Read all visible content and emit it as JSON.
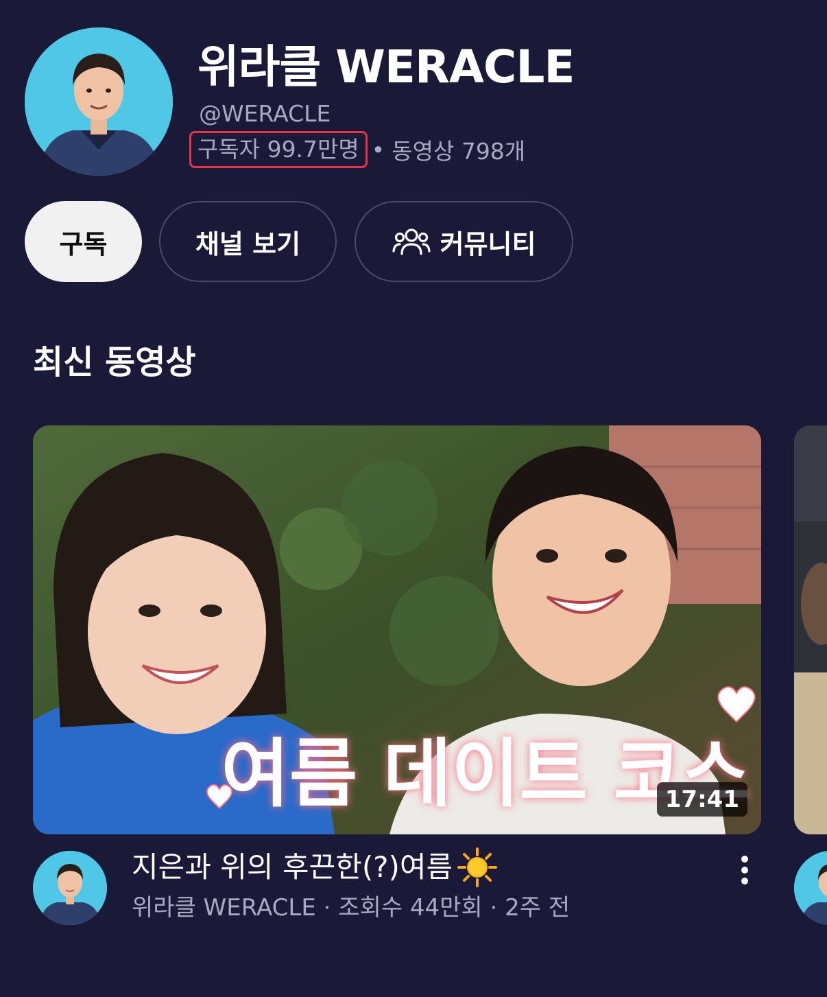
{
  "channel": {
    "name": "위라클 WERACLE",
    "handle": "@WERACLE",
    "subscribers": "구독자 99.7만명",
    "separator": "•",
    "video_count": "동영상 798개"
  },
  "actions": {
    "subscribe_label": "구독",
    "view_channel_label": "채널 보기",
    "community_label": "커뮤니티",
    "community_icon": "people-icon"
  },
  "section": {
    "title": "최신 동영상"
  },
  "video": {
    "thumbnail_text": "여름 데이트 코스",
    "duration": "17:41",
    "title": "지은과 위의 후끈한(?)여름",
    "title_emoji_icon": "sun-icon",
    "meta": "위라클 WERACLE · 조회수 44만회 · 2주 전"
  },
  "colors": {
    "background": "#1a1a38",
    "subscribe_button": "#f1f1f1",
    "highlight_box": "#e8334a",
    "secondary_text": "#a9a9c4"
  }
}
